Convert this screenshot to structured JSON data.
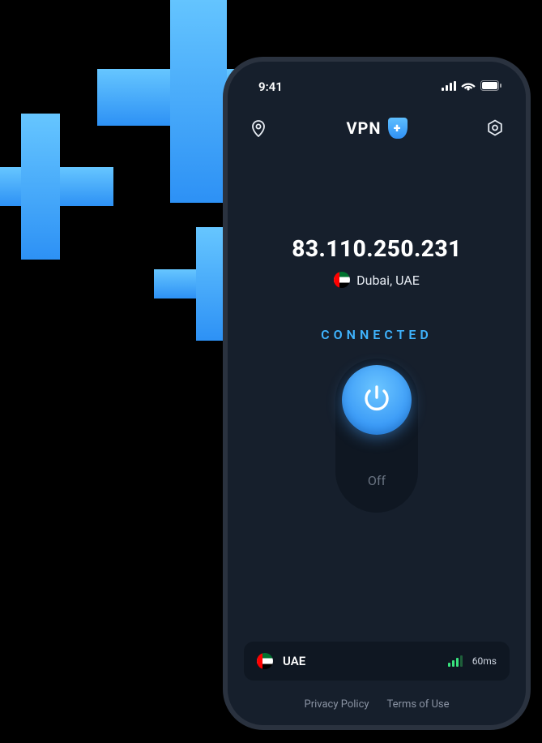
{
  "statusbar": {
    "time": "9:41"
  },
  "header": {
    "title": "VPN"
  },
  "connection": {
    "ip": "83.110.250.231",
    "location": "Dubai, UAE",
    "status": "CONNECTED"
  },
  "toggle": {
    "off_label": "Off"
  },
  "server": {
    "name": "UAE",
    "ping": "60ms"
  },
  "footer": {
    "privacy": "Privacy Policy",
    "terms": "Terms of Use"
  }
}
